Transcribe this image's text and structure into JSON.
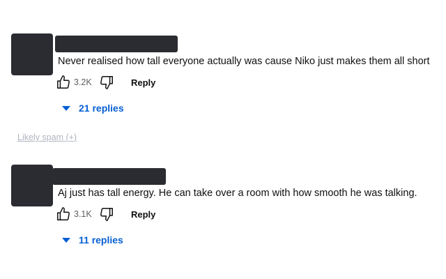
{
  "comments": [
    {
      "text": "Never realised how tall everyone actually was cause Niko just makes them all short",
      "likes": "3.2K",
      "reply_label": "Reply",
      "replies_label": "21 replies"
    },
    {
      "text": "Aj just has tall energy. He can take over a room with how smooth he was talking.",
      "likes": "3.1K",
      "reply_label": "Reply",
      "replies_label": "11 replies"
    }
  ],
  "spam_link": "Likely spam (+)",
  "icons": {
    "like": "thumbs-up-icon",
    "dislike": "thumbs-down-icon",
    "expand": "caret-down-icon"
  },
  "colors": {
    "redaction": "#2b2c31",
    "link_blue": "#065fd4",
    "muted_link": "#aeb4c0"
  }
}
